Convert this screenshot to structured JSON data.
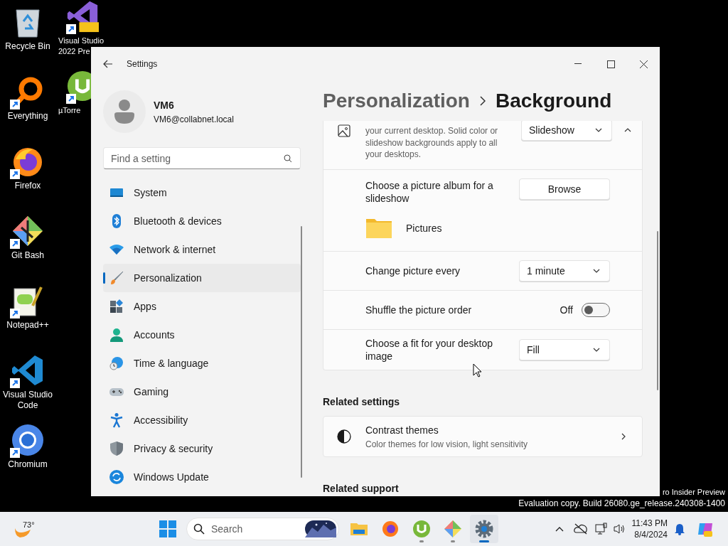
{
  "desktop_icons": [
    {
      "kind": "recycle",
      "lines": [
        "Recycle Bin"
      ],
      "shortcut": false
    },
    {
      "kind": "everything",
      "lines": [
        "Everything"
      ],
      "shortcut": true
    },
    {
      "kind": "firefox",
      "lines": [
        "Firefox"
      ],
      "shortcut": true
    },
    {
      "kind": "gitbash",
      "lines": [
        "Git Bash"
      ],
      "shortcut": true
    },
    {
      "kind": "notepadpp",
      "lines": [
        "Notepad++"
      ],
      "shortcut": true
    },
    {
      "kind": "vscode",
      "lines": [
        "Visual Studio",
        "Code"
      ],
      "shortcut": true
    },
    {
      "kind": "chromium",
      "lines": [
        "Chromium"
      ],
      "shortcut": true
    }
  ],
  "desktop_icons_behind_window": [
    {
      "kind": "visualstudio",
      "lines": [
        "Visual Studio",
        "2022 Pre"
      ],
      "shortcut": true
    },
    {
      "kind": "utorrent",
      "lines": [
        "µTorre"
      ],
      "shortcut": true
    }
  ],
  "window": {
    "title": "Settings"
  },
  "profile": {
    "name": "VM6",
    "email": "VM6@collabnet.local"
  },
  "search": {
    "placeholder": "Find a setting"
  },
  "nav": {
    "items": [
      {
        "kind": "system",
        "label": "System",
        "selected": false
      },
      {
        "kind": "bluetooth",
        "label": "Bluetooth & devices",
        "selected": false
      },
      {
        "kind": "network",
        "label": "Network & internet",
        "selected": false
      },
      {
        "kind": "personalization",
        "label": "Personalization",
        "selected": true
      },
      {
        "kind": "apps",
        "label": "Apps",
        "selected": false
      },
      {
        "kind": "accounts",
        "label": "Accounts",
        "selected": false
      },
      {
        "kind": "time",
        "label": "Time & language",
        "selected": false
      },
      {
        "kind": "gaming",
        "label": "Gaming",
        "selected": false
      },
      {
        "kind": "accessibility",
        "label": "Accessibility",
        "selected": false
      },
      {
        "kind": "privacy",
        "label": "Privacy & security",
        "selected": false
      },
      {
        "kind": "update",
        "label": "Windows Update",
        "selected": false
      }
    ]
  },
  "breadcrumb": [
    "Personalization",
    "Background"
  ],
  "background_card": {
    "description": "your current desktop. Solid color or slideshow backgrounds apply to all your desktops.",
    "dropdown": "Slideshow",
    "expanded": true
  },
  "album": {
    "label": "Choose a picture album for a slideshow",
    "button": "Browse",
    "folder": "Pictures"
  },
  "rows": [
    {
      "kind": "dropdown",
      "label": "Change picture every",
      "value": "1 minute"
    },
    {
      "kind": "toggle",
      "label": "Shuffle the picture order",
      "value": "Off",
      "on": false
    },
    {
      "kind": "dropdown",
      "label": "Choose a fit for your desktop image",
      "value": "Fill"
    }
  ],
  "related_settings": {
    "heading": "Related settings",
    "items": [
      {
        "title": "Contrast themes",
        "subtitle": "Color themes for low vision, light sensitivity"
      }
    ]
  },
  "related_support": {
    "heading": "Related support"
  },
  "watermark": [
    "ro Insider Preview",
    "Evaluation copy. Build 26080.ge_release.240308-1400"
  ],
  "taskbar": {
    "weather": "73°",
    "search_placeholder": "Search",
    "apps": [
      {
        "kind": "explorer",
        "selected": false,
        "running": false
      },
      {
        "kind": "firefox",
        "selected": false,
        "running": false
      },
      {
        "kind": "utorrent",
        "selected": false,
        "running": true
      },
      {
        "kind": "gitbash",
        "selected": false,
        "running": true
      },
      {
        "kind": "settings",
        "selected": true,
        "running": true
      }
    ],
    "time": "11:43 PM",
    "date": "8/4/2024"
  }
}
